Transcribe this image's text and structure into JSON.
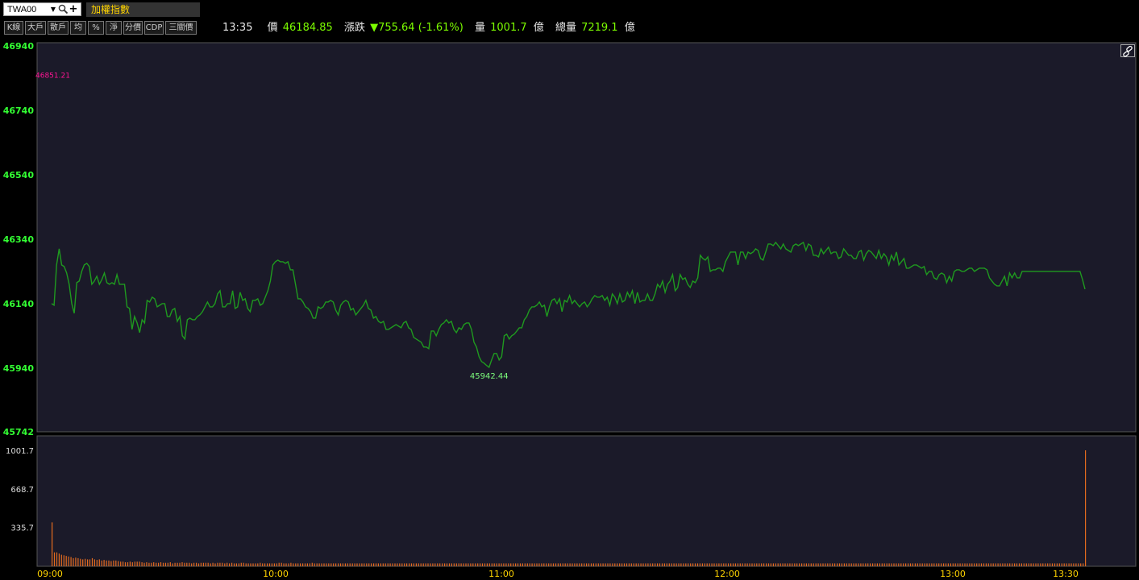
{
  "symbol": {
    "code": "TWA00",
    "name": "加權指數"
  },
  "toolbar_buttons": [
    "K線",
    "大戶",
    "散戶",
    "均",
    "%",
    "淨",
    "分價",
    "CDP",
    "三關價"
  ],
  "quote": {
    "time": "13:35",
    "price_label": "價",
    "price": "46184.85",
    "change_label": "漲跌",
    "change": "▼755.64 (-1.61%)",
    "volume_label": "量",
    "volume": "1001.7",
    "volume_unit": "億",
    "total_label": "總量",
    "total_volume": "7219.1",
    "total_unit": "億"
  },
  "chart_data": {
    "type": "line",
    "price_ticks": [
      "46940",
      "46740",
      "46540",
      "46340",
      "46140",
      "45940",
      "45742"
    ],
    "volume_ticks": [
      "1001.7",
      "668.7",
      "335.7"
    ],
    "time_ticks": [
      "09:00",
      "10:00",
      "11:00",
      "12:00",
      "13:00",
      "13:30"
    ],
    "high_label": "46851.21",
    "low_label": "45942.44",
    "ylim": [
      45742,
      46940
    ],
    "volume_max": 1001.7,
    "series": [
      {
        "values": [
          46140,
          46135,
          46260,
          46310,
          46260,
          46255,
          46235,
          46200,
          46140,
          46110,
          46205,
          46210,
          46240,
          46260,
          46265,
          46255,
          46200,
          46210,
          46225,
          46200,
          46215,
          46235,
          46205,
          46200,
          46205,
          46200,
          46230,
          46200,
          46200,
          46200,
          46130,
          46125,
          46060,
          46100,
          46080,
          46050,
          46090,
          46080,
          46150,
          46145,
          46160,
          46155,
          46130,
          46135,
          46140,
          46140,
          46100,
          46100,
          46120,
          46125,
          46085,
          46100,
          46040,
          46030,
          46090,
          46095,
          46090,
          46090,
          46100,
          46105,
          46115,
          46130,
          46145,
          46130,
          46130,
          46140,
          46170,
          46180,
          46130,
          46130,
          46140,
          46140,
          46180,
          46125,
          46130,
          46175,
          46150,
          46155,
          46125,
          46115,
          46150,
          46150,
          46155,
          46135,
          46140,
          46160,
          46180,
          46210,
          46260,
          46270,
          46275,
          46270,
          46270,
          46265,
          46270,
          46245,
          46245,
          46200,
          46155,
          46155,
          46145,
          46130,
          46125,
          46115,
          46095,
          46095,
          46130,
          46125,
          46130,
          46145,
          46145,
          46150,
          46145,
          46120,
          46105,
          46135,
          46145,
          46150,
          46145,
          46120,
          46125,
          46105,
          46115,
          46125,
          46135,
          46150,
          46125,
          46120,
          46095,
          46100,
          46085,
          46080,
          46085,
          46060,
          46060,
          46065,
          46070,
          46075,
          46070,
          46065,
          46080,
          46085,
          46065,
          46060,
          46035,
          46030,
          46025,
          46020,
          46005,
          46005,
          46000,
          46055,
          46055,
          46040,
          46060,
          46075,
          46080,
          46090,
          46080,
          46085,
          46060,
          46050,
          46065,
          46060,
          46075,
          46080,
          46080,
          46060,
          46020,
          46005,
          45975,
          45960,
          45955,
          45948,
          45942,
          45965,
          45985,
          45985,
          45965,
          45975,
          46040,
          46045,
          46030,
          46040,
          46045,
          46055,
          46065,
          46065,
          46090,
          46100,
          46120,
          46130,
          46130,
          46135,
          46145,
          46130,
          46135,
          46100,
          46130,
          46150,
          46155,
          46140,
          46155,
          46115,
          46150,
          46145,
          46165,
          46140,
          46150,
          46140,
          46130,
          46140,
          46145,
          46130,
          46140,
          46155,
          46165,
          46160,
          46160,
          46165,
          46150,
          46160,
          46135,
          46170,
          46160,
          46140,
          46170,
          46145,
          46150,
          46175,
          46160,
          46180,
          46140,
          46175,
          46145,
          46150,
          46150,
          46170,
          46150,
          46150,
          46170,
          46200,
          46190,
          46210,
          46175,
          46200,
          46210,
          46230,
          46180,
          46190,
          46230,
          46215,
          46220,
          46200,
          46190,
          46210,
          46205,
          46220,
          46290,
          46280,
          46275,
          46285,
          46240,
          46245,
          46245,
          46250,
          46250,
          46240,
          46270,
          46285,
          46300,
          46300,
          46300,
          46260,
          46300,
          46300,
          46280,
          46300,
          46295,
          46300,
          46310,
          46305,
          46280,
          46275,
          46300,
          46325,
          46325,
          46320,
          46330,
          46320,
          46310,
          46325,
          46310,
          46305,
          46300,
          46320,
          46325,
          46320,
          46325,
          46330,
          46305,
          46325,
          46320,
          46290,
          46290,
          46285,
          46310,
          46295,
          46305,
          46315,
          46295,
          46300,
          46300,
          46280,
          46285,
          46310,
          46300,
          46290,
          46290,
          46280,
          46280,
          46300,
          46305,
          46275,
          46295,
          46305,
          46300,
          46290,
          46280,
          46305,
          46280,
          46295,
          46285,
          46260,
          46290,
          46275,
          46300,
          46260,
          46270,
          46280,
          46250,
          46250,
          46255,
          46260,
          46260,
          46255,
          46250,
          46255,
          46230,
          46240,
          46240,
          46220,
          46215,
          46230,
          46235,
          46230,
          46205,
          46225,
          46210,
          46240,
          46245,
          46245,
          46240,
          46240,
          46245,
          46250,
          46250,
          46240,
          46245,
          46250,
          46250,
          46250,
          46245,
          46220,
          46210,
          46200,
          46195,
          46195,
          46210,
          46225,
          46195,
          46235,
          46220,
          46235,
          46220,
          46220,
          46240,
          46240,
          46240,
          46240,
          46240,
          46240,
          46240,
          46240,
          46240,
          46240,
          46240,
          46240,
          46240,
          46240,
          46240,
          46240,
          46240,
          46240,
          46240,
          46240,
          46240,
          46240,
          46240,
          46240,
          46215,
          46184.85
        ]
      }
    ],
    "volume": [
      380,
      120,
      120,
      110,
      100,
      95,
      90,
      85,
      80,
      70,
      75,
      70,
      65,
      60,
      65,
      60,
      60,
      70,
      60,
      55,
      60,
      50,
      55,
      50,
      50,
      45,
      50,
      50,
      45,
      40,
      40,
      35,
      35,
      40,
      35,
      40,
      40,
      40,
      35,
      30,
      35,
      30,
      30,
      35,
      30,
      30,
      35,
      30,
      30,
      30,
      35,
      25,
      30,
      30,
      30,
      35,
      30,
      30,
      30,
      25,
      30,
      30,
      25,
      30,
      30,
      30,
      30,
      25,
      30,
      25,
      30,
      30,
      30,
      25,
      30,
      25,
      30,
      25,
      25,
      25,
      30,
      30,
      25,
      25,
      25,
      25,
      25,
      25,
      30,
      25,
      25,
      25,
      25,
      25,
      25,
      25,
      30,
      30,
      25,
      25,
      25,
      30,
      25,
      25,
      25,
      25,
      25,
      25,
      25,
      25,
      30,
      25,
      25,
      25,
      25,
      25,
      25,
      25,
      25,
      25,
      25,
      25,
      25,
      25,
      25,
      25,
      25,
      25,
      25,
      25,
      25,
      25,
      25,
      25,
      25,
      25,
      25,
      25,
      25,
      25,
      25,
      25,
      25,
      25,
      25,
      25,
      25,
      25,
      25,
      25,
      25,
      25,
      25,
      25,
      25,
      25,
      25,
      25,
      25,
      25,
      25,
      25,
      25,
      25,
      25,
      25,
      25,
      25,
      25,
      25,
      25,
      25,
      25,
      25,
      25,
      25,
      25,
      25,
      25,
      25,
      25,
      25,
      25,
      25,
      25,
      25,
      25,
      25,
      25,
      25,
      25,
      25,
      25,
      25,
      25,
      25,
      25,
      25,
      25,
      25,
      25,
      25,
      25,
      25,
      25,
      25,
      25,
      25,
      25,
      25,
      25,
      25,
      25,
      25,
      25,
      25,
      25,
      25,
      25,
      25,
      25,
      25,
      25,
      25,
      25,
      25,
      25,
      25,
      25,
      25,
      25,
      25,
      25,
      25,
      25,
      25,
      25,
      25,
      25,
      25,
      25,
      25,
      25,
      25,
      25,
      25,
      25,
      25,
      25,
      25,
      25,
      25,
      25,
      25,
      25,
      25,
      25,
      25,
      25,
      25,
      25,
      25,
      25,
      25,
      25,
      25,
      25,
      25,
      25,
      25,
      25,
      25,
      25,
      25,
      25,
      25,
      25,
      25,
      25,
      25,
      25,
      25,
      25,
      25,
      25,
      25,
      25,
      25,
      25,
      25,
      25,
      25,
      25,
      25,
      25,
      25,
      25,
      25,
      25,
      25,
      25,
      25,
      25,
      25,
      25,
      25,
      25,
      25,
      25,
      25,
      25,
      25,
      25,
      25,
      25,
      25,
      25,
      25,
      25,
      25,
      25,
      25,
      25,
      25,
      25,
      25,
      25,
      25,
      25,
      25,
      25,
      25,
      25,
      25,
      25,
      25,
      25,
      25,
      25,
      25,
      25,
      25,
      25,
      25,
      25,
      25,
      25,
      25,
      25,
      25,
      25,
      25,
      25,
      25,
      25,
      25,
      25,
      25,
      25,
      25,
      25,
      25,
      25,
      25,
      25,
      25,
      25,
      25,
      25,
      25,
      25,
      25,
      25,
      25,
      25,
      25,
      25,
      25,
      25,
      25,
      25,
      25,
      25,
      25,
      25,
      25,
      25,
      25,
      25,
      25,
      25,
      25,
      25,
      25,
      25,
      25,
      25,
      25,
      25,
      25,
      25,
      25,
      25,
      25,
      25,
      25,
      25,
      25,
      25,
      25,
      25,
      25,
      25,
      25,
      25,
      25,
      25,
      25,
      25,
      25,
      25,
      25,
      25,
      25,
      25,
      25,
      25,
      25,
      25,
      25,
      25,
      25,
      25,
      25,
      25,
      25,
      25,
      1001.7
    ]
  },
  "colors": {
    "background": "#1b1a29",
    "price_line": "#1f9a1f",
    "price_tick": "#33ff33",
    "volume_bar": "#e36b1e",
    "high_marker": "#ff1493",
    "low_marker": "#7cfc7c",
    "time_tick": "#ffd400",
    "grid": "#4a4a5a"
  }
}
